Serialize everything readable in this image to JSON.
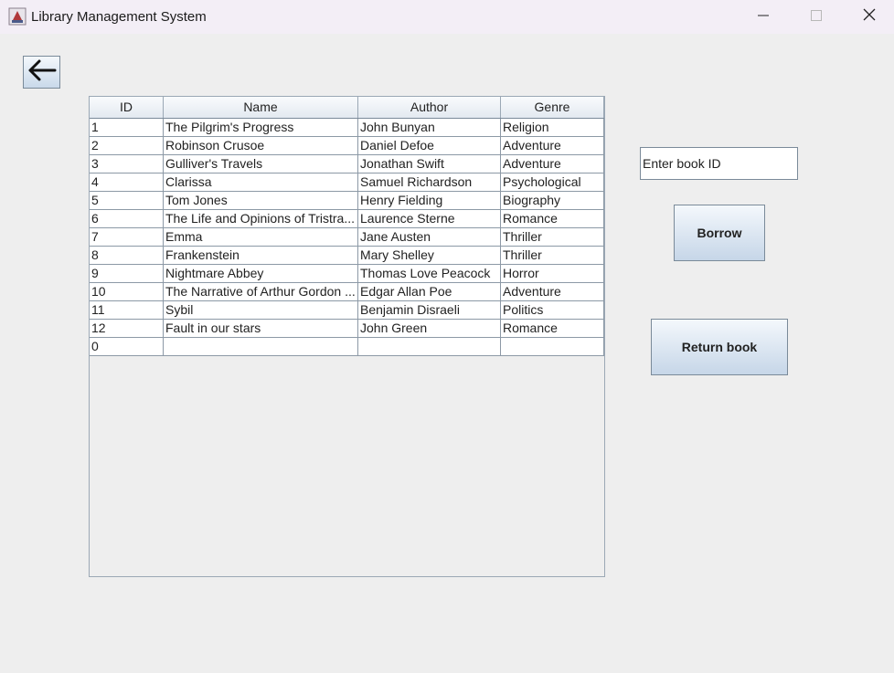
{
  "window": {
    "title": "Library Management System",
    "icons": {
      "app": "java-cup-icon",
      "minimize": "minimize-icon",
      "maximize": "maximize-icon",
      "close": "close-icon"
    }
  },
  "back_button": {
    "icon": "arrow-left-icon"
  },
  "table": {
    "columns": [
      "ID",
      "Name",
      "Author",
      "Genre"
    ],
    "rows": [
      [
        "1",
        "The Pilgrim's Progress",
        "John Bunyan",
        "Religion"
      ],
      [
        "2",
        "Robinson Crusoe",
        " Daniel Defoe",
        "Adventure"
      ],
      [
        "3",
        "Gulliver's Travels",
        "Jonathan Swift",
        "Adventure"
      ],
      [
        "4",
        "Clarissa",
        "Samuel Richardson",
        "Psychological"
      ],
      [
        "5",
        "Tom Jones",
        "Henry Fielding",
        "Biography"
      ],
      [
        "6",
        "The Life and Opinions of Tristra...",
        "Laurence Sterne",
        "Romance"
      ],
      [
        "7",
        "Emma",
        "Jane Austen",
        "Thriller"
      ],
      [
        "8",
        "Frankenstein",
        "Mary Shelley",
        "Thriller"
      ],
      [
        "9",
        "Nightmare Abbey",
        "Thomas Love Peacock",
        "Horror"
      ],
      [
        "10",
        "The Narrative of Arthur Gordon ...",
        "Edgar Allan Poe",
        "Adventure"
      ],
      [
        "11",
        "Sybil",
        "Benjamin Disraeli",
        "Politics"
      ],
      [
        "12",
        "Fault in our stars",
        "John Green",
        "Romance"
      ],
      [
        "0",
        "",
        "",
        ""
      ]
    ]
  },
  "book_id_input": {
    "value": "Enter book ID"
  },
  "buttons": {
    "borrow": "Borrow",
    "return": "Return book"
  }
}
